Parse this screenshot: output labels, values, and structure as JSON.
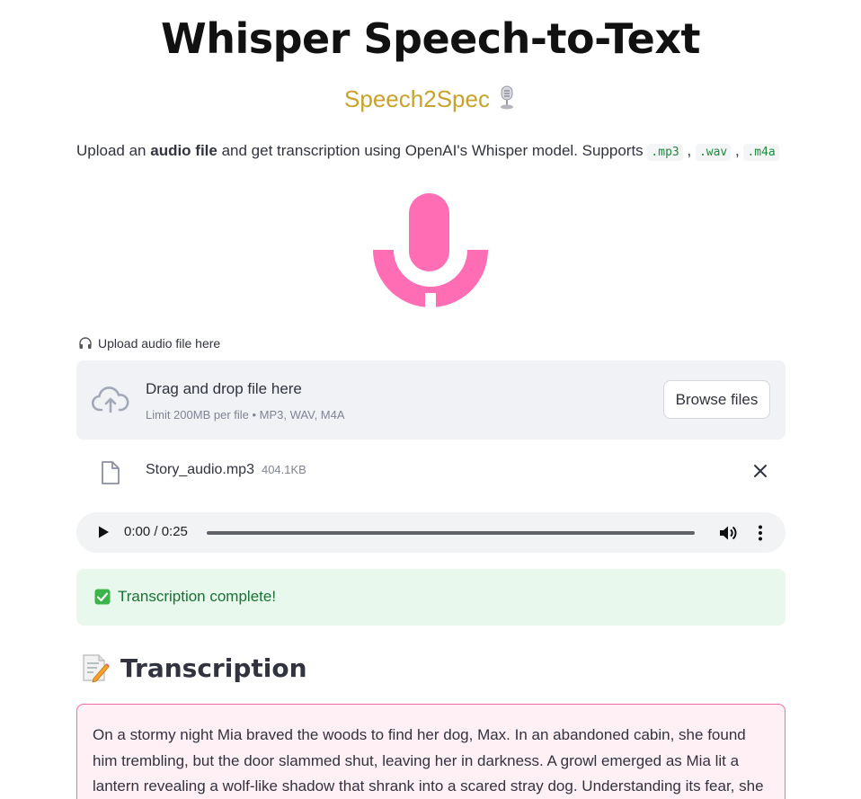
{
  "header": {
    "title": "Whisper Speech-to-Text",
    "subtitle": "Speech2Spec"
  },
  "intro": {
    "text_before": "Upload an ",
    "bold": "audio file",
    "text_after": " and get transcription using OpenAI's Whisper model. Supports ",
    "formats": [
      ".mp3",
      ".wav",
      ".m4a"
    ],
    "separator": ","
  },
  "uploader": {
    "label": "Upload audio file here",
    "drag_text": "Drag and drop file here",
    "limit_text": "Limit 200MB per file • MP3, WAV, M4A",
    "browse_label": "Browse files"
  },
  "file": {
    "name": "Story_audio.mp3",
    "size": "404.1KB"
  },
  "player": {
    "time": "0:00 / 0:25",
    "progress": 0
  },
  "status": {
    "message": "Transcription complete!"
  },
  "transcription": {
    "heading": "Transcription",
    "text": "On a stormy night Mia braved the woods to find her dog, Max. In an abandoned cabin, she found him trembling, but the door slammed shut, leaving her in darkness. A growl emerged as Mia lit a lantern revealing a wolf-like shadow that shrank into a scared stray dog. Understanding its fear, she calmed"
  },
  "colors": {
    "logo": "#ff6eb4",
    "subtitle": "#c9a22a",
    "success_bg": "#e8f8ec",
    "success_text": "#177233",
    "transcript_border": "#f06ba8",
    "transcript_bg": "#fff0f5"
  }
}
